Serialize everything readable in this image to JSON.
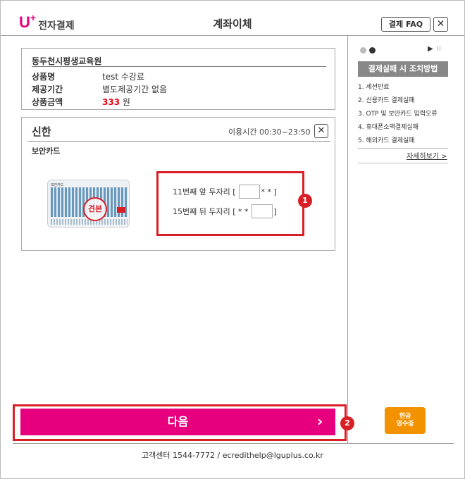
{
  "header": {
    "logo_u": "U",
    "logo_plus": "+",
    "logo_text": "전자결제",
    "title": "계좌이체",
    "faq_label": "결제 FAQ",
    "close_label": "✕"
  },
  "info": {
    "org": "동두천시평생교육원",
    "rows": [
      {
        "label": "상품명",
        "value": "test 수강료"
      },
      {
        "label": "제공기간",
        "value": "별도제공기간 없음"
      },
      {
        "label": "상품금액",
        "value": "원"
      }
    ],
    "price": "333"
  },
  "card": {
    "bank": "신한",
    "usage": "이용시간 00:30~23:50",
    "close_label": "✕",
    "subtitle": "보안카드",
    "card_header": "보안카드",
    "stamp": "견본",
    "row1_prefix": "11번째 앞 두자리 [",
    "row1_suffix": "* * ]",
    "row2_prefix": "15번째 뒤 두자리 [ * *",
    "row2_suffix": "]",
    "badge1": "1"
  },
  "next": {
    "label": "다음",
    "arrow": "›",
    "badge2": "2"
  },
  "footer": {
    "text": "고객센터 1544-7772 / ecredithelp@lguplus.co.kr"
  },
  "side": {
    "play": "▶",
    "pause": "II",
    "fail_title": "결제실패 시 조치방법",
    "fail_items": [
      "1. 세션만료",
      "2. 신용카드 결제실패",
      "3. OTP 및 보안카드 입력오류",
      "4. 휴대폰소액결제실패",
      "5. 해외카드 결제실패"
    ],
    "more": "자세히보기 >",
    "receipt_line1": "현금",
    "receipt_line2": "영수증"
  },
  "colors": {
    "brand": "#e6007e",
    "highlight": "#d81f26",
    "receipt": "#f39200"
  }
}
